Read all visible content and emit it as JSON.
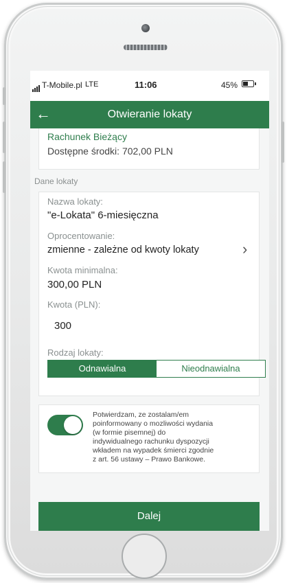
{
  "status_bar": {
    "carrier": "T-Mobile.pl",
    "network": "LTE",
    "time": "11:06",
    "battery": "45%"
  },
  "header": {
    "title": "Otwieranie lokaty",
    "back_icon": "arrow-left"
  },
  "account": {
    "name": "Rachunek Bieżący",
    "funds": "Dostępne środki: 702,00 PLN"
  },
  "section": {
    "label": "Dane lokaty"
  },
  "deposit": {
    "name_label": "Nazwa lokaty:",
    "name_value": "\"e-Lokata\" 6-miesięczna",
    "rate_label": "Oprocentowanie:",
    "rate_value": "zmienne - zależne od kwoty lokaty",
    "min_label": "Kwota minimalna:",
    "min_value": "300,00 PLN",
    "amount_label": "Kwota (PLN):",
    "amount_value": "300",
    "type_label": "Rodzaj lokaty:",
    "type_options": [
      "Odnawialna",
      "Nieodnawialna"
    ],
    "type_selected": "Odnawialna"
  },
  "consent": {
    "enabled": true,
    "lines": [
      "Potwierdzam, ze zostalam/em",
      "poinformowany o mozliwości wydania",
      "(w formie pisemnej) do",
      "indywidualnego rachunku dyspozycji",
      "wkładem na wypadek śmierci zgodnie",
      "z art. 56 ustawy – Prawo Bankowe."
    ]
  },
  "footer": {
    "next_label": "Dalej"
  },
  "colors": {
    "primary": "#2e7d4c",
    "background": "#f5f6f6",
    "text": "#222222"
  }
}
